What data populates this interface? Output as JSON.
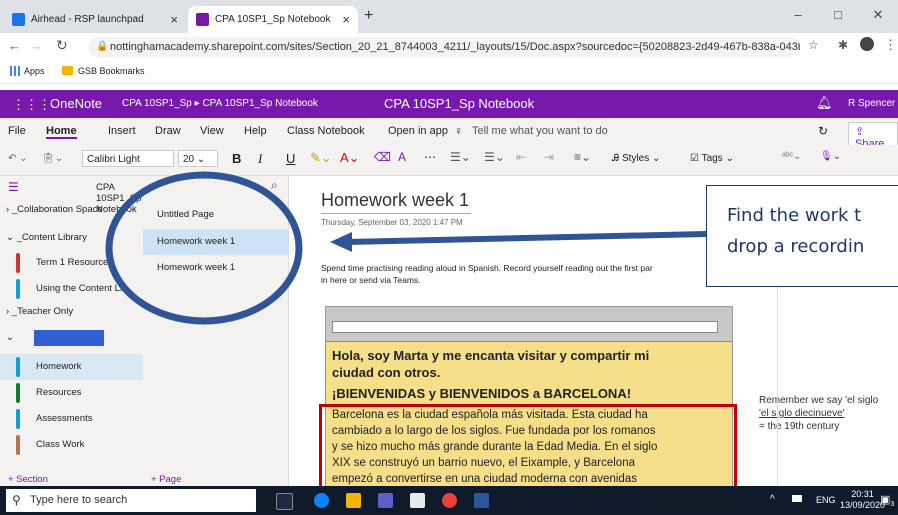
{
  "browser": {
    "tabs": [
      {
        "title": "Airhead - RSP launchpad",
        "active": false
      },
      {
        "title": "CPA 10SP1_Sp Notebook",
        "active": true
      }
    ],
    "new_tab": "+",
    "url": "nottinghamacademy.sharepoint.com/sites/Section_20_21_8744003_4211/_layouts/15/Doc.aspx?sourcedoc={50208823-2d49-467b-838a-043b3c446...",
    "bookmarks": [
      "Apps",
      "GSB Bookmarks"
    ],
    "window_controls": [
      "–",
      "□",
      "✕"
    ]
  },
  "onenote": {
    "app_name": "OneNote",
    "breadcrumb": [
      "CPA 10SP1_Sp",
      "CPA 10SP1_Sp Notebook"
    ],
    "doc_title": "CPA 10SP1_Sp Notebook",
    "user": "R Spencer",
    "ribbon_tabs": [
      "File",
      "Home",
      "Insert",
      "Draw",
      "View",
      "Help",
      "Class Notebook",
      "Open in app"
    ],
    "active_ribbon_tab": "Home",
    "tell_me": "Tell me what you want to do",
    "share": "Share",
    "font": "Calibri Light",
    "font_size": "20",
    "styles": "Styles",
    "tags": "Tags"
  },
  "sections": {
    "notebook_title": "CPA 10SP1_Sp Notebook",
    "groups": [
      {
        "label": "_Collaboration Space",
        "expanded": false
      },
      {
        "label": "_Content Library",
        "expanded": true
      },
      {
        "label": "_Teacher Only",
        "expanded": false
      }
    ],
    "library_items": [
      {
        "label": "Term 1 Resources",
        "color": "#d13438"
      },
      {
        "label": "Using the Content Li...",
        "color": "#0f9ed5"
      }
    ],
    "student_items": [
      {
        "label": "Homework",
        "color": "#0f9ed5"
      },
      {
        "label": "Resources",
        "color": "#0f7b3f"
      },
      {
        "label": "Assessments",
        "color": "#0f9ed5"
      },
      {
        "label": "Class Work",
        "color": "#a97a52"
      }
    ],
    "add_section": "+ Section"
  },
  "pages": {
    "items": [
      "Untitled Page",
      "Homework week 1",
      "Homework week 1"
    ],
    "selected_index": 1,
    "add_page": "+ Page"
  },
  "note": {
    "title": "Homework week 1",
    "timestamp": "Thursday, September 03, 2020   1:47 PM",
    "body_line1": "Spend time practising reading aloud in Spanish. Record yourself reading out the first par",
    "body_line2": "in here or send via Teams.",
    "image_heading1": "Hola, soy Marta y me encanta visitar y compartir mi",
    "image_heading2": "ciudad con otros.",
    "image_heading3": "¡BIENVENIDAS y BIENVENIDOS a BARCELONA!",
    "image_text": [
      "Barcelona es la ciudad española más visitada. Esta ciudad ha",
      "cambiado a lo largo de los siglos. Fue fundada por los romanos",
      "y se hizo mucho más grande durante la Edad Media. En el siglo",
      "XIX se construyó un barrio nuevo, el Eixample, y Barcelona",
      "empezó a convertirse en una ciudad moderna con avenidas"
    ],
    "side_note": [
      "Remember we say 'el siglo",
      "'el siglo diecinueve'",
      "= the 19th century"
    ]
  },
  "callout": {
    "line1": "Find the work t",
    "line2": "drop a recordin"
  },
  "taskbar": {
    "search_placeholder": "Type here to search",
    "language": "ENG",
    "time": "20:31",
    "date": "13/09/2020",
    "notification_count": "3"
  },
  "colors": {
    "onenote_purple": "#7719aa",
    "highlight_blue": "#2f5597",
    "redaction_blue": "#2f5fd3",
    "red_box": "#c00000"
  }
}
